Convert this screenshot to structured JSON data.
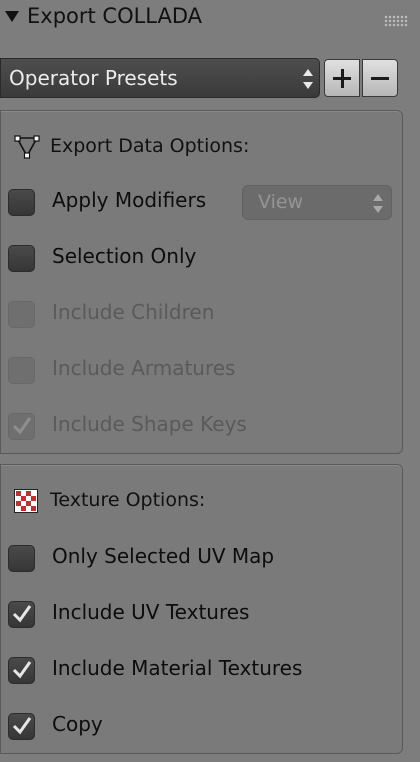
{
  "panel": {
    "title": "Export COLLADA"
  },
  "presets": {
    "label": "Operator Presets",
    "add_icon": "plus-icon",
    "remove_icon": "minus-icon"
  },
  "export_data": {
    "title": "Export Data Options:",
    "icon": "mesh-vertex-icon",
    "apply_modifiers": {
      "label": "Apply Modifiers",
      "checked": false,
      "enabled": true
    },
    "apply_modifiers_mode": {
      "value": "View",
      "enabled": false
    },
    "selection_only": {
      "label": "Selection Only",
      "checked": false,
      "enabled": true
    },
    "include_children": {
      "label": "Include Children",
      "checked": false,
      "enabled": false
    },
    "include_armatures": {
      "label": "Include Armatures",
      "checked": false,
      "enabled": false
    },
    "include_shape_keys": {
      "label": "Include Shape Keys",
      "checked": true,
      "enabled": false
    }
  },
  "texture": {
    "title": "Texture Options:",
    "icon": "checker-texture-icon",
    "only_selected_uv_map": {
      "label": "Only Selected UV Map",
      "checked": false,
      "enabled": true
    },
    "include_uv_textures": {
      "label": "Include UV Textures",
      "checked": true,
      "enabled": true
    },
    "include_material_textures": {
      "label": "Include Material Textures",
      "checked": true,
      "enabled": true
    },
    "copy": {
      "label": "Copy",
      "checked": true,
      "enabled": true
    }
  }
}
